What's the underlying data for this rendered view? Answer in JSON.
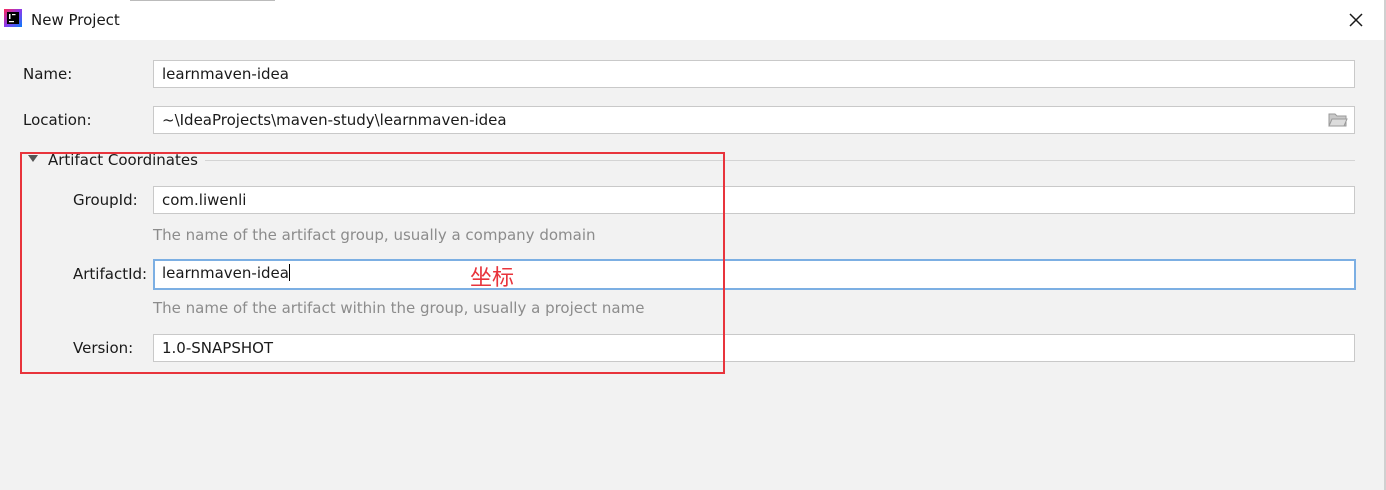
{
  "window": {
    "title": "New Project",
    "app_icon": "intellij-idea-icon",
    "close_icon": "close-icon"
  },
  "form": {
    "name": {
      "label": "Name:",
      "value": "learnmaven-idea"
    },
    "location": {
      "label": "Location:",
      "value": "~\\IdeaProjects\\maven-study\\learnmaven-idea",
      "browse_icon": "folder-icon"
    },
    "artifact_section": {
      "title": "Artifact Coordinates",
      "expanded": true,
      "group_id": {
        "label": "GroupId:",
        "value": "com.liwenli",
        "hint": "The name of the artifact group, usually a company domain"
      },
      "artifact_id": {
        "label": "ArtifactId:",
        "value": "learnmaven-idea",
        "hint": "The name of the artifact within the group, usually a project name"
      },
      "version": {
        "label": "Version:",
        "value": "1.0-SNAPSHOT"
      }
    }
  },
  "annotation": {
    "text": "坐标",
    "color": "#e8343c"
  },
  "colors": {
    "focus_border": "#7cafe3",
    "annotation_red": "#e8343c",
    "background": "#f2f2f2"
  }
}
